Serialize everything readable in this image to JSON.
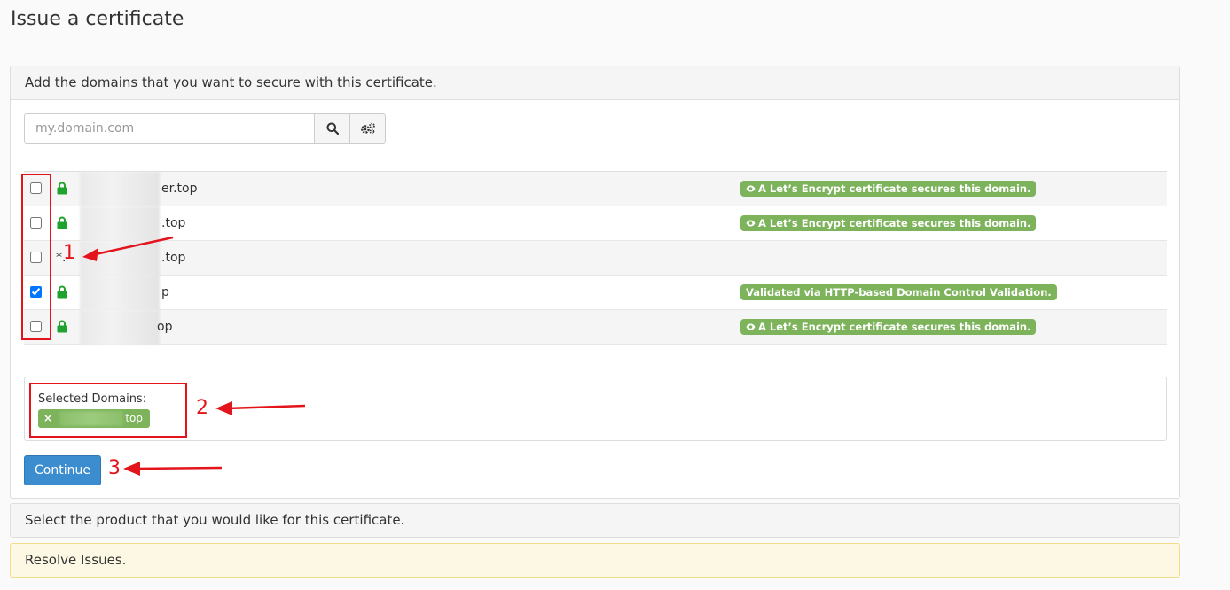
{
  "page": {
    "title": "Issue a certificate"
  },
  "domains_panel": {
    "heading": "Add the domains that you want to secure with this certificate.",
    "search": {
      "placeholder": "my.domain.com",
      "value": ""
    },
    "rows": [
      {
        "checked": false,
        "lock": true,
        "domain": "er.top",
        "status": "A Let’s Encrypt certificate secures this domain.",
        "status_icon": "eye-icon"
      },
      {
        "checked": false,
        "lock": true,
        "domain": ".top",
        "status": "A Let’s Encrypt certificate secures this domain.",
        "status_icon": "eye-icon"
      },
      {
        "checked": false,
        "lock": false,
        "domain_prefix": "*.",
        "domain": ".top",
        "status": ""
      },
      {
        "checked": true,
        "lock": true,
        "domain": "p",
        "status": "Validated via HTTP-based Domain Control Validation.",
        "status_icon": ""
      },
      {
        "checked": false,
        "lock": true,
        "domain": "op",
        "status": "A Let’s Encrypt certificate secures this domain.",
        "status_icon": "eye-icon"
      }
    ],
    "selected": {
      "label": "Selected Domains:",
      "chips": [
        {
          "remove": "×",
          "text": "top"
        }
      ]
    },
    "continue_label": "Continue"
  },
  "product_panel": {
    "heading": "Select the product that you would like for this certificate."
  },
  "issues_alert": {
    "text": "Resolve Issues."
  },
  "annotations": {
    "one": "1",
    "two": "2",
    "three": "3"
  },
  "colors": {
    "badge_green": "#7cb35b",
    "lock_green": "#1fa22e",
    "primary_blue": "#3c8dd0",
    "annotation_red": "#e3141b",
    "warning_bg": "#fcf8e3"
  }
}
